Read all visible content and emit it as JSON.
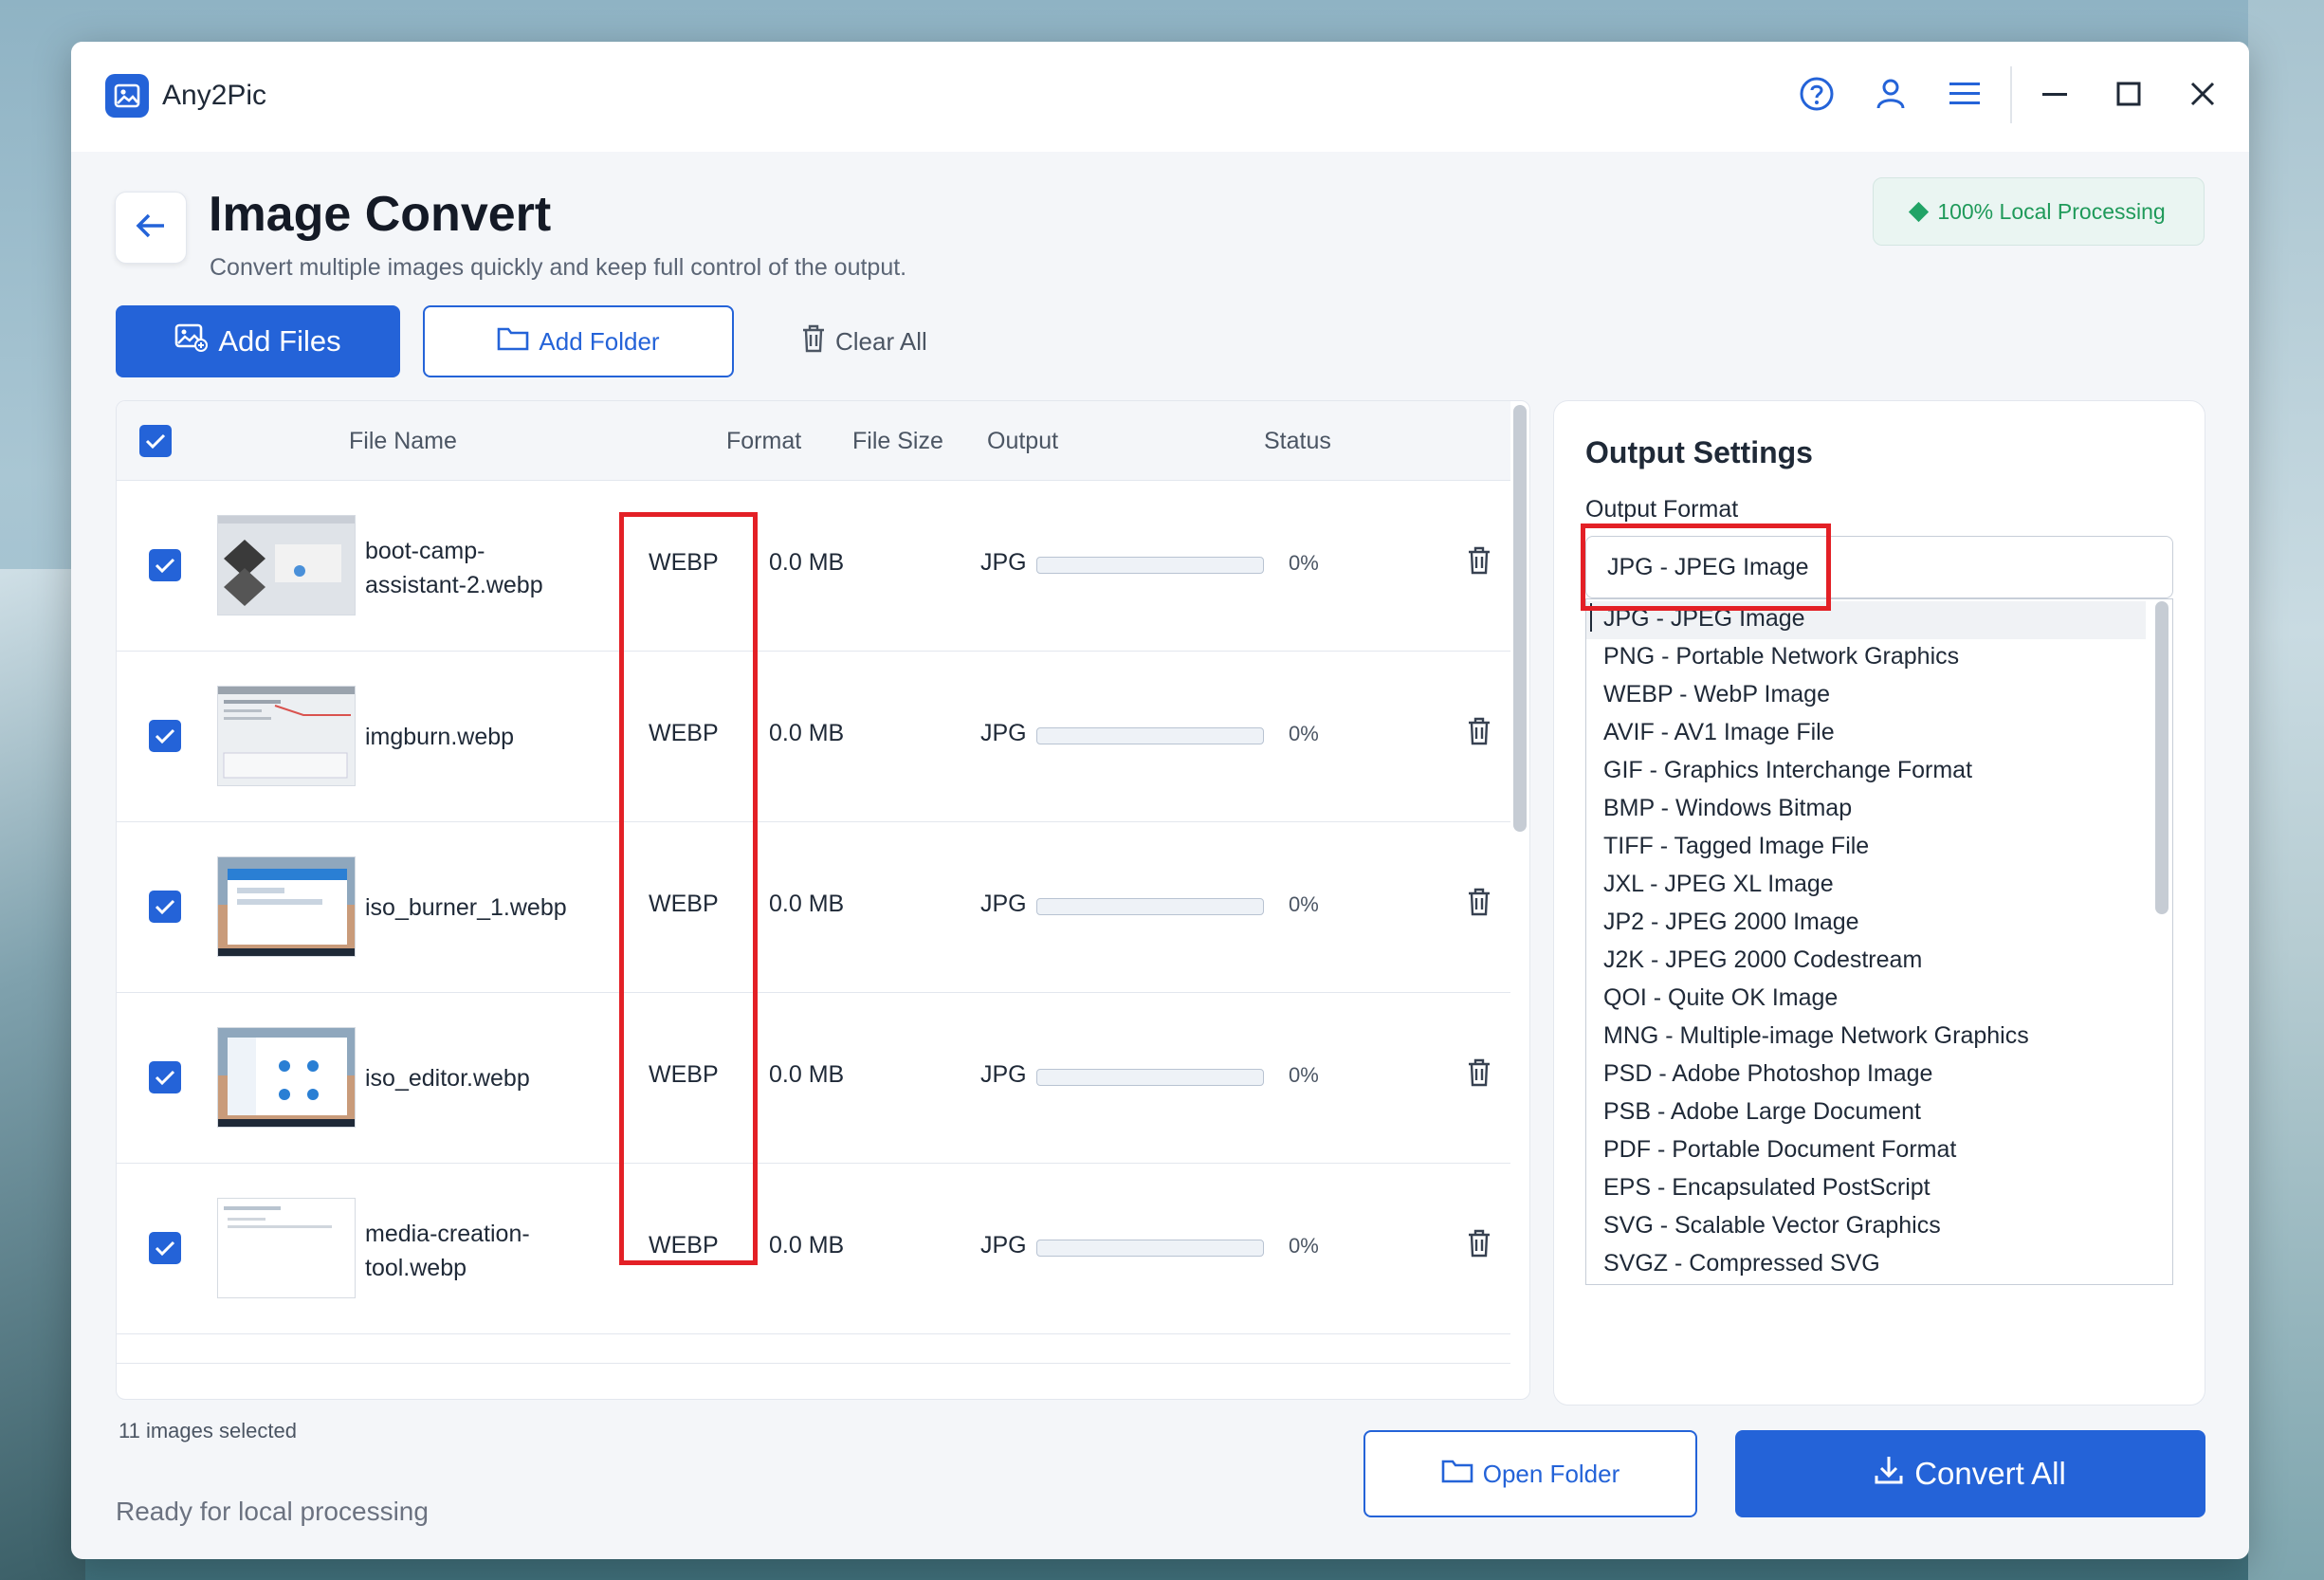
{
  "app": {
    "name": "Any2Pic"
  },
  "header": {
    "title": "Image Convert",
    "subtitle": "Convert multiple images quickly and keep full control of the output.",
    "badge": "100% Local Processing"
  },
  "toolbar": {
    "add_files": "Add Files",
    "add_folder": "Add Folder",
    "clear_all": "Clear All"
  },
  "table": {
    "columns": {
      "file_name": "File Name",
      "format": "Format",
      "file_size": "File Size",
      "output": "Output",
      "status": "Status"
    },
    "rows": [
      {
        "name_line1": "boot-camp-",
        "name_line2": "assistant-2.webp",
        "format": "WEBP",
        "size": "0.0 MB",
        "output": "JPG",
        "progress": 0,
        "percent": "0%"
      },
      {
        "name_line1": "imgburn.webp",
        "name_line2": "",
        "format": "WEBP",
        "size": "0.0 MB",
        "output": "JPG",
        "progress": 0,
        "percent": "0%"
      },
      {
        "name_line1": "iso_burner_1.webp",
        "name_line2": "",
        "format": "WEBP",
        "size": "0.0 MB",
        "output": "JPG",
        "progress": 0,
        "percent": "0%"
      },
      {
        "name_line1": "iso_editor.webp",
        "name_line2": "",
        "format": "WEBP",
        "size": "0.0 MB",
        "output": "JPG",
        "progress": 0,
        "percent": "0%"
      },
      {
        "name_line1": "media-creation-",
        "name_line2": "tool.webp",
        "format": "WEBP",
        "size": "0.0 MB",
        "output": "JPG",
        "progress": 0,
        "percent": "0%"
      }
    ]
  },
  "footer": {
    "selected_count": "11 images selected",
    "ready": "Ready for local processing",
    "open_folder": "Open Folder",
    "convert_all": "Convert All"
  },
  "settings": {
    "title": "Output Settings",
    "format_label": "Output Format",
    "selected_format": "JPG - JPEG Image",
    "options": [
      "JPG - JPEG Image",
      "PNG - Portable Network Graphics",
      "WEBP - WebP Image",
      "AVIF - AV1 Image File",
      "GIF - Graphics Interchange Format",
      "BMP - Windows Bitmap",
      "TIFF - Tagged Image File",
      "JXL - JPEG XL Image",
      "JP2 - JPEG 2000 Image",
      "J2K - JPEG 2000 Codestream",
      "QOI - Quite OK Image",
      "MNG - Multiple-image Network Graphics",
      "PSD - Adobe Photoshop Image",
      "PSB - Adobe Large Document",
      "PDF - Portable Document Format",
      "EPS - Encapsulated PostScript",
      "SVG - Scalable Vector Graphics",
      "SVGZ - Compressed SVG"
    ]
  },
  "colors": {
    "accent": "#2463d8",
    "highlight": "#e32026",
    "badge_text": "#1f9a5a"
  },
  "icons": {
    "help": "help-circle-icon",
    "account": "user-icon",
    "menu": "hamburger-icon",
    "minimize": "minimize-icon",
    "maximize": "maximize-icon",
    "close": "close-icon",
    "back": "arrow-left-icon",
    "add_files": "image-add-icon",
    "folder": "folder-icon",
    "trash": "trash-icon",
    "download": "download-icon"
  }
}
